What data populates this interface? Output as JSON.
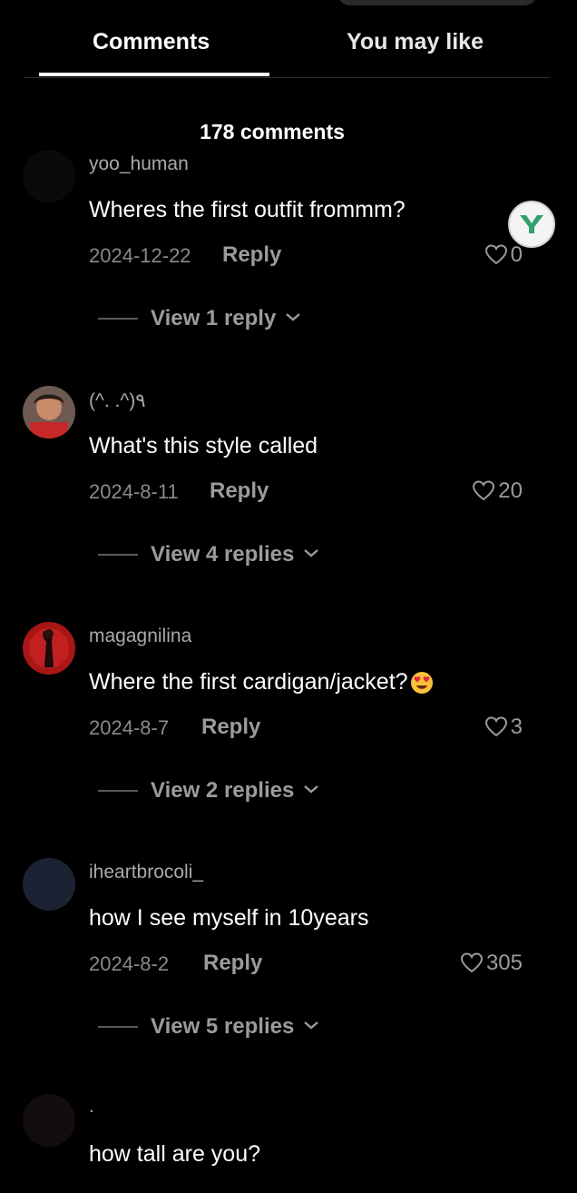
{
  "tabs": {
    "comments": "Comments",
    "you_may_like": "You may like"
  },
  "comment_count": "178 comments",
  "comments": [
    {
      "username": "yoo_human",
      "text": "Wheres the first outfit frommm?",
      "date": "2024-12-22",
      "reply_label": "Reply",
      "likes": "0",
      "view_replies": "View 1 reply",
      "avatar_color": "#0a0a0a"
    },
    {
      "username": "(^. .^)٩",
      "text": "What's this style called",
      "date": "2024-8-11",
      "reply_label": "Reply",
      "likes": "20",
      "view_replies": "View 4 replies",
      "avatar_color": "#7a4a3a"
    },
    {
      "username": "magagnilina",
      "text": "Where the first cardigan/jacket?",
      "emoji": "heart-eyes-emoji",
      "date": "2024-8-7",
      "reply_label": "Reply",
      "likes": "3",
      "view_replies": "View 2 replies",
      "avatar_color": "#9b1a1a"
    },
    {
      "username": "iheartbrocoli_",
      "text": "how I see myself in 10years",
      "date": "2024-8-2",
      "reply_label": "Reply",
      "likes": "305",
      "view_replies": "View 5 replies",
      "avatar_color": "#1c2234"
    },
    {
      "username": ".",
      "text": "how tall are you?",
      "avatar_color": "#130d10"
    }
  ],
  "floating_badge": {
    "icon": "y-logo-icon",
    "color": "#2fa36b"
  },
  "colors": {
    "background": "#000000",
    "secondary_text": "#9b9b9b"
  }
}
